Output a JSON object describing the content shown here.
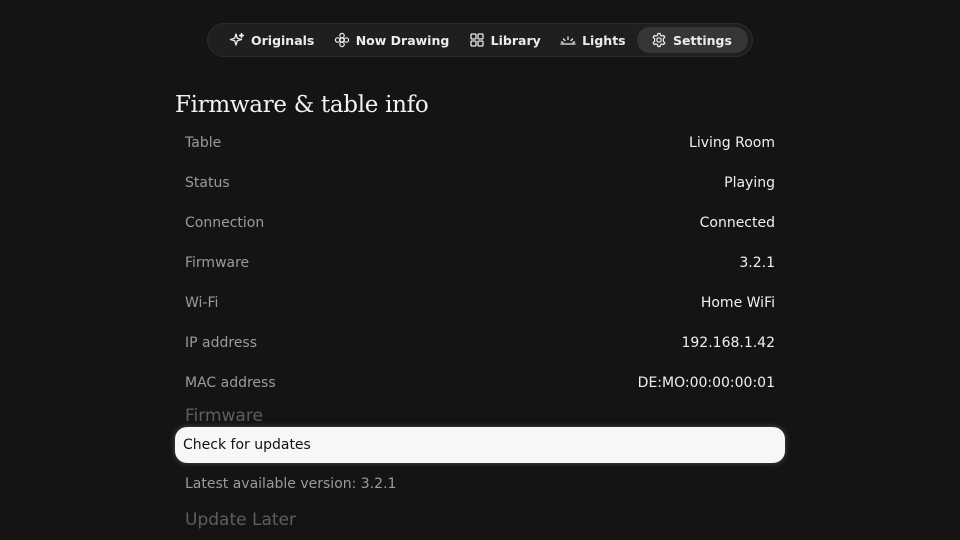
{
  "nav": {
    "items": [
      {
        "label": "Originals",
        "icon": "sparkle-icon",
        "active": false
      },
      {
        "label": "Now Drawing",
        "icon": "flower-icon",
        "active": false
      },
      {
        "label": "Library",
        "icon": "grid-icon",
        "active": false
      },
      {
        "label": "Lights",
        "icon": "sunrise-icon",
        "active": false
      },
      {
        "label": "Settings",
        "icon": "gear-icon",
        "active": true
      }
    ]
  },
  "page": {
    "title": "Firmware & table info"
  },
  "info": {
    "rows": [
      {
        "label": "Table",
        "value": "Living Room"
      },
      {
        "label": "Status",
        "value": "Playing"
      },
      {
        "label": "Connection",
        "value": "Connected"
      },
      {
        "label": "Firmware",
        "value": "3.2.1"
      },
      {
        "label": "Wi-Fi",
        "value": "Home WiFi"
      },
      {
        "label": "IP address",
        "value": "192.168.1.42"
      },
      {
        "label": "MAC address",
        "value": "DE:MO:00:00:00:01"
      }
    ]
  },
  "firmware": {
    "section_label": "Firmware",
    "check_button": "Check for updates",
    "latest_text": "Latest available version: 3.2.1",
    "update_later": "Update Later"
  },
  "colors": {
    "background": "#141414",
    "nav_background": "#1f1f1f",
    "nav_active": "#363636",
    "focus_button": "#f7f7f7",
    "label_grey": "#9b9b9b",
    "dim_grey": "#5e5e5e"
  }
}
